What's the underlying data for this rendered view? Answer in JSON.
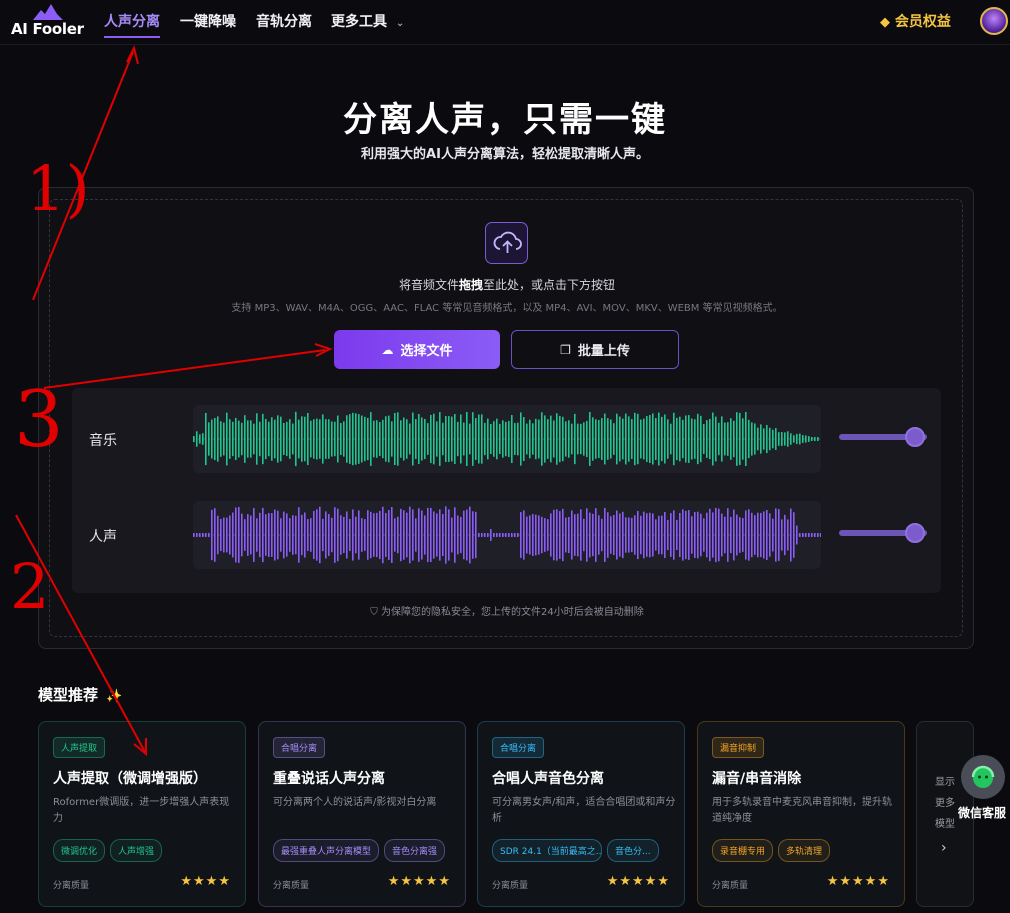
{
  "brand": {
    "name": "AI Fooler",
    "logo_color": "#8b5cf6"
  },
  "nav": {
    "items": [
      {
        "label": "人声分离",
        "active": true
      },
      {
        "label": "一键降噪",
        "active": false
      },
      {
        "label": "音轨分离",
        "active": false
      },
      {
        "label": "更多工具",
        "active": false
      }
    ],
    "member_label": "会员权益",
    "more_icon": "chevron-down-icon",
    "member_icon": "diamond-icon"
  },
  "hero": {
    "title": "分离人声，只需一键",
    "subtitle": "利用强大的AI人声分离算法，轻松提取清晰人声。"
  },
  "upload": {
    "drop_prefix": "将音频文件",
    "drop_bold": "拖拽",
    "drop_suffix": "至此处，或点击下方按钮",
    "formats": "支持 MP3、WAV、M4A、OGG、AAC、FLAC 等常见音频格式，以及 MP4、AVI、MOV、MKV、WEBM 等常见视频格式。",
    "select_button": "选择文件",
    "batch_button": "批量上传",
    "privacy": "为保障您的隐私安全，您上传的文件24小时后会被自动删除"
  },
  "tracks": [
    {
      "label": "音乐",
      "color": "#22c58e",
      "volume": 1.0
    },
    {
      "label": "人声",
      "color": "#8b5cf6",
      "volume": 1.0
    }
  ],
  "models": {
    "section_title": "模型推荐",
    "quality_label": "分离质量",
    "cards": [
      {
        "tag": "人声提取",
        "tag_color": "#22c58e",
        "title": "人声提取（微调增强版）",
        "desc": "Roformer微调版，进一步增强人声表现力",
        "chips": [
          "微调优化",
          "人声增强"
        ],
        "chip_color": "#22c58e",
        "stars": "★★★★"
      },
      {
        "tag": "合唱分离",
        "tag_color": "#a78bfa",
        "title": "重叠说话人声分离",
        "desc": "可分离两个人的说话声/影视对白分离",
        "chips": [
          "最强重叠人声分离模型",
          "音色分离强"
        ],
        "chip_color": "#a78bfa",
        "stars": "★★★★★"
      },
      {
        "tag": "合唱分离",
        "tag_color": "#38bdf8",
        "title": "合唱人声音色分离",
        "desc": "可分离男女声/和声，适合合唱团或和声分析",
        "chips": [
          "SDR 24.1（当前最高之...",
          "音色分..."
        ],
        "chip_color": "#38bdf8",
        "stars": "★★★★★"
      },
      {
        "tag": "漏音抑制",
        "tag_color": "#f5a524",
        "title": "漏音/串音消除",
        "desc": "用于多轨录音中麦克风串音抑制，提升轨道纯净度",
        "chips": [
          "录音棚专用",
          "多轨清理"
        ],
        "chip_color": "#f5a524",
        "stars": "★★★★★"
      }
    ],
    "more_card": {
      "lines": [
        "显示",
        "更多",
        "模型"
      ]
    }
  },
  "support": {
    "label": "微信客服",
    "icon": "headset-icon"
  },
  "annotations": {
    "mark1": "1)",
    "mark2": "2",
    "mark3": "3",
    "color": "#e00000"
  }
}
